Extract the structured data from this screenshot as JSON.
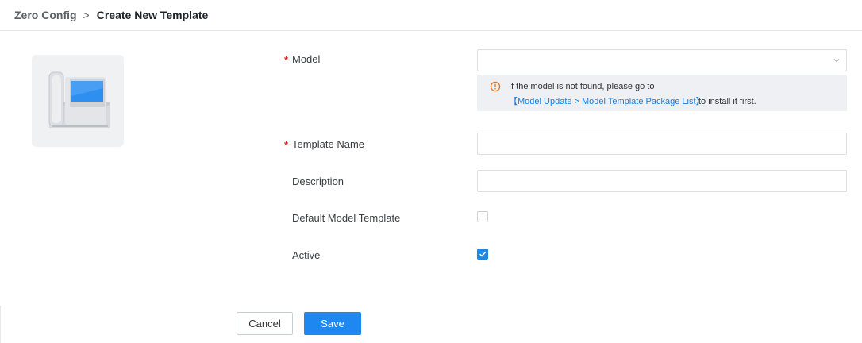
{
  "breadcrumb": {
    "parent": "Zero Config",
    "separator": ">",
    "current": "Create New Template"
  },
  "device": {
    "icon": "desk-phone-icon"
  },
  "form": {
    "model": {
      "required_mark": "*",
      "label": "Model",
      "value": "",
      "icon": "chevron-down-icon"
    },
    "notice": {
      "icon": "warning-circle-icon",
      "line1": "If the model is not found, please go to",
      "link": "【Model Update > Model Template Package List】",
      "after_link": "to install it first."
    },
    "template_name": {
      "required_mark": "*",
      "label": "Template Name",
      "value": ""
    },
    "description": {
      "label": "Description",
      "value": ""
    },
    "default_model_template": {
      "label": "Default Model Template",
      "checked": false
    },
    "active": {
      "label": "Active",
      "checked": true
    }
  },
  "actions": {
    "cancel_label": "Cancel",
    "save_label": "Save"
  },
  "colors": {
    "primary": "#1e88f0",
    "required": "#e02020",
    "warning": "#e8711a",
    "link": "#1a7fe0"
  }
}
